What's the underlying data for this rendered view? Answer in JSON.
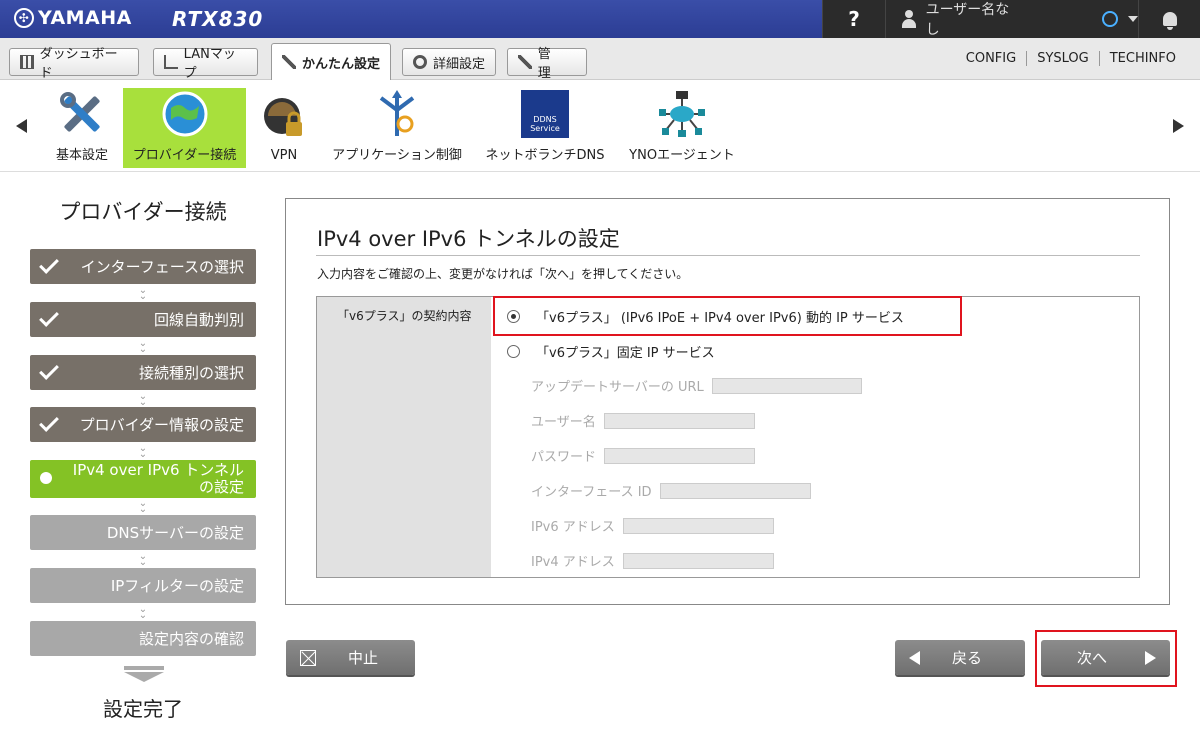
{
  "header": {
    "brand": "YAMAHA",
    "model": "RTX830",
    "help_label": "?",
    "user_label": "ユーザー名なし"
  },
  "tabs": [
    {
      "label": "ダッシュボード",
      "icon": "dashboard-icon"
    },
    {
      "label": "LANマップ",
      "icon": "lan-map-icon"
    },
    {
      "label": "かんたん設定",
      "icon": "wand-icon",
      "active": true
    },
    {
      "label": "詳細設定",
      "icon": "gear-icon"
    },
    {
      "label": "管　理",
      "icon": "wrench-icon"
    }
  ],
  "top_links": [
    "CONFIG",
    "SYSLOG",
    "TECHINFO"
  ],
  "functions": [
    {
      "label": "基本設定",
      "icon": "tools-icon"
    },
    {
      "label": "プロバイダー接続",
      "icon": "globe-icon",
      "active": true
    },
    {
      "label": "VPN",
      "icon": "vpn-lock-icon"
    },
    {
      "label": "アプリケーション制御",
      "icon": "app-control-icon"
    },
    {
      "label": "ネットボランチDNS",
      "icon": "ddns-service-icon",
      "badge_text": "DDNS Service"
    },
    {
      "label": "YNOエージェント",
      "icon": "yno-agent-icon"
    }
  ],
  "sidebar": {
    "title": "プロバイダー接続",
    "steps": [
      {
        "label": "インターフェースの選択",
        "state": "done"
      },
      {
        "label": "回線自動判別",
        "state": "done"
      },
      {
        "label": "接続種別の選択",
        "state": "done"
      },
      {
        "label": "プロバイダー情報の設定",
        "state": "done"
      },
      {
        "label": "IPv4 over IPv6 トンネル\nの設定",
        "state": "current"
      },
      {
        "label": "DNSサーバーの設定",
        "state": "todo"
      },
      {
        "label": "IPフィルターの設定",
        "state": "todo"
      },
      {
        "label": "設定内容の確認",
        "state": "todo"
      }
    ],
    "complete_label": "設定完了"
  },
  "main": {
    "title": "IPv4 over IPv6 トンネルの設定",
    "instruction": "入力内容をご確認の上、変更がなければ「次へ」を押してください。",
    "form_label": "「v6プラス」の契約内容",
    "options": [
      {
        "label": "「v6プラス」 (IPv6 IPoE + IPv4 over IPv6) 動的 IP サービス",
        "selected": true
      },
      {
        "label": "「v6プラス」固定 IP サービス",
        "selected": false
      }
    ],
    "sub_fields": [
      {
        "label": "アップデートサーバーの URL",
        "value": ""
      },
      {
        "label": "ユーザー名",
        "value": ""
      },
      {
        "label": "パスワード",
        "value": ""
      },
      {
        "label": "インターフェース ID",
        "value": ""
      },
      {
        "label": "IPv6 アドレス",
        "value": ""
      },
      {
        "label": "IPv4 アドレス",
        "value": ""
      }
    ]
  },
  "buttons": {
    "cancel": "中止",
    "back": "戻る",
    "next": "次へ"
  },
  "colors": {
    "header_blue": "#2c3d94",
    "active_green": "#84c225",
    "highlight_red": "#e0141e"
  }
}
